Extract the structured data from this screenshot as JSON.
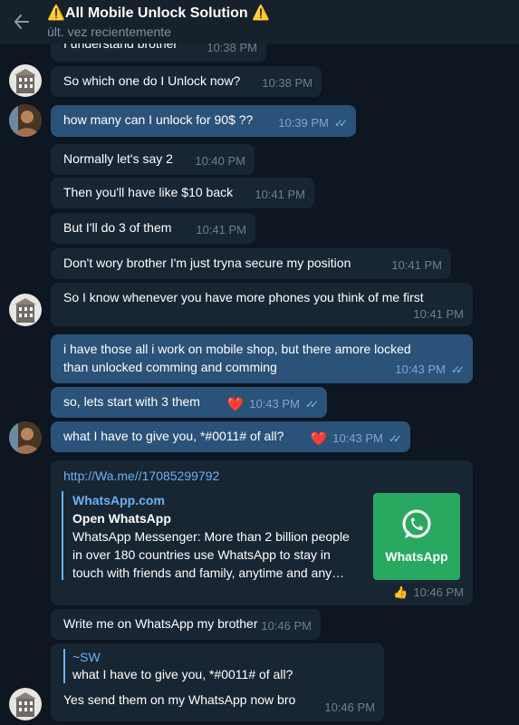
{
  "header": {
    "title": "⚠️All Mobile Unlock Solution ⚠️",
    "status": "últ. vez recientemente",
    "back_icon": "arrow-left-icon"
  },
  "colors": {
    "background": "#0e1621",
    "header": "#17212b",
    "incoming_bubble": "#182533",
    "outgoing_bubble": "#2b5278",
    "link": "#6ab3f3",
    "whatsapp_green": "#29a95f"
  },
  "messages": [
    {
      "id": "m0",
      "dir": "in",
      "text": "I understand brother",
      "time": "10:38 PM"
    },
    {
      "id": "m1",
      "dir": "in",
      "text": "So which one do I Unlock now?",
      "time": "10:38 PM"
    },
    {
      "id": "m2",
      "dir": "out",
      "text": "how many can I unlock for 90$ ??",
      "time": "10:39 PM",
      "read": true
    },
    {
      "id": "m3",
      "dir": "in",
      "text": "Normally let's say 2",
      "time": "10:40 PM"
    },
    {
      "id": "m4",
      "dir": "in",
      "text": "Then you'll have like $10 back",
      "time": "10:41 PM"
    },
    {
      "id": "m5",
      "dir": "in",
      "text": "But I'll do 3 of them",
      "time": "10:41 PM"
    },
    {
      "id": "m6",
      "dir": "in",
      "text": "Don't wory brother I'm just tryna secure my position",
      "time": "10:41 PM"
    },
    {
      "id": "m7",
      "dir": "in",
      "text": "So I know whenever you have more phones you think of me first",
      "time": "10:41 PM"
    },
    {
      "id": "m8",
      "dir": "out",
      "line1": "i have those all i work on mobile shop, but there amore locked",
      "line2": "than unlocked comming and comming",
      "time": "10:43 PM",
      "read": true
    },
    {
      "id": "m9",
      "dir": "out",
      "text": "so, lets start with 3 them",
      "time": "10:43 PM",
      "reaction": "❤️",
      "read": true
    },
    {
      "id": "m10",
      "dir": "out",
      "text": "what I have to give you, *#0011# of all?",
      "time": "10:43 PM",
      "reaction": "❤️",
      "read": true
    },
    {
      "id": "m11",
      "dir": "in",
      "text": "http://Wa.me//17085299792",
      "time": "10:46 PM",
      "reaction": "👍",
      "preview": {
        "site": "WhatsApp.com",
        "title": "Open WhatsApp",
        "description": "WhatsApp Messenger: More than 2 billion people in over 180 countries use WhatsApp to stay in touch with friends and family, anytime and any…",
        "thumb_label": "WhatsApp"
      }
    },
    {
      "id": "m12",
      "dir": "in",
      "text": "Write me on WhatsApp my brother",
      "time": "10:46 PM"
    },
    {
      "id": "m13",
      "dir": "in",
      "text": "Yes send them on my WhatsApp now bro",
      "time": "10:46 PM",
      "reply": {
        "name": "~SW",
        "text": "what I have to give you, *#0011# of all?"
      }
    }
  ]
}
